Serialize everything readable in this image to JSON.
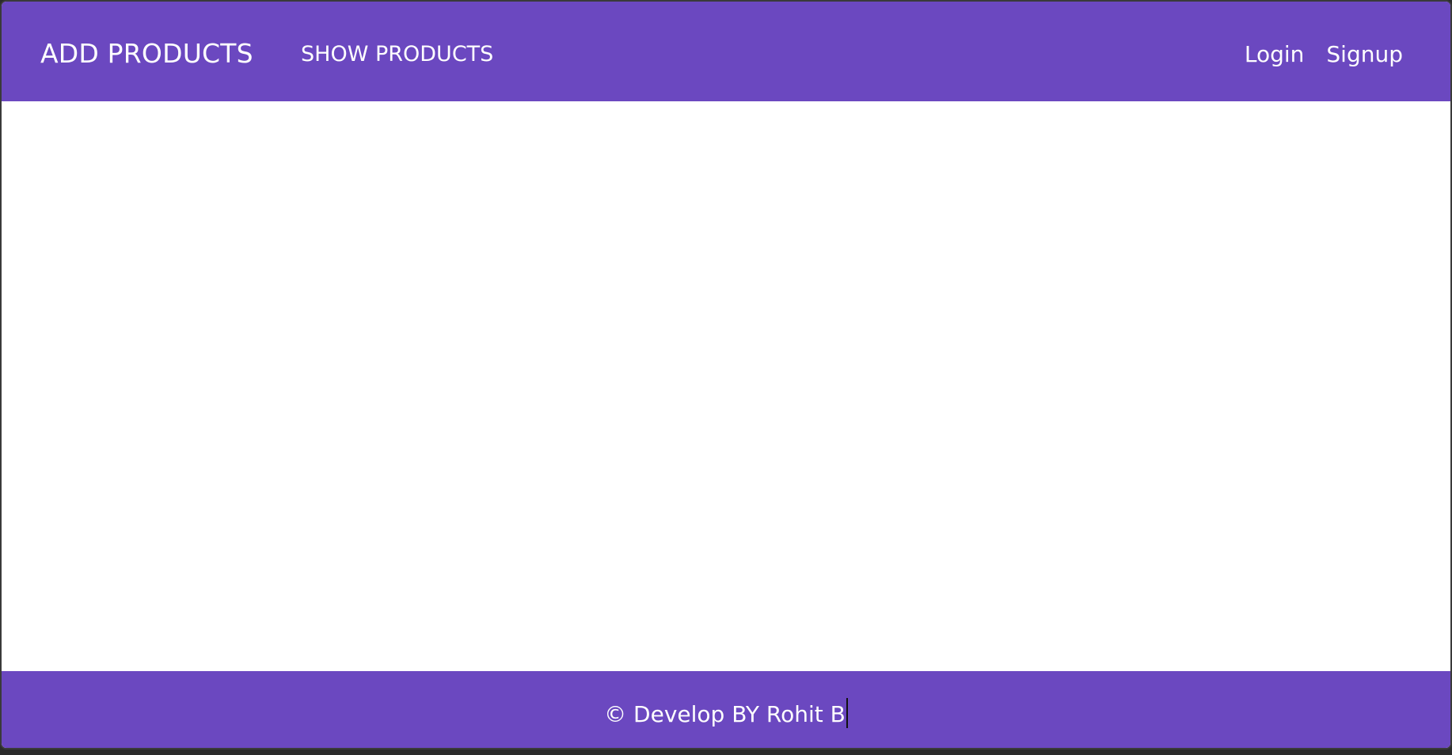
{
  "navbar": {
    "brand": "ADD PRODUCTS",
    "link": "SHOW PRODUCTS",
    "login": "Login",
    "signup": "Signup"
  },
  "footer": {
    "text": "© Develop BY Rohit B"
  },
  "colors": {
    "primary": "#6b48c0",
    "text": "#ffffff",
    "background": "#ffffff"
  }
}
